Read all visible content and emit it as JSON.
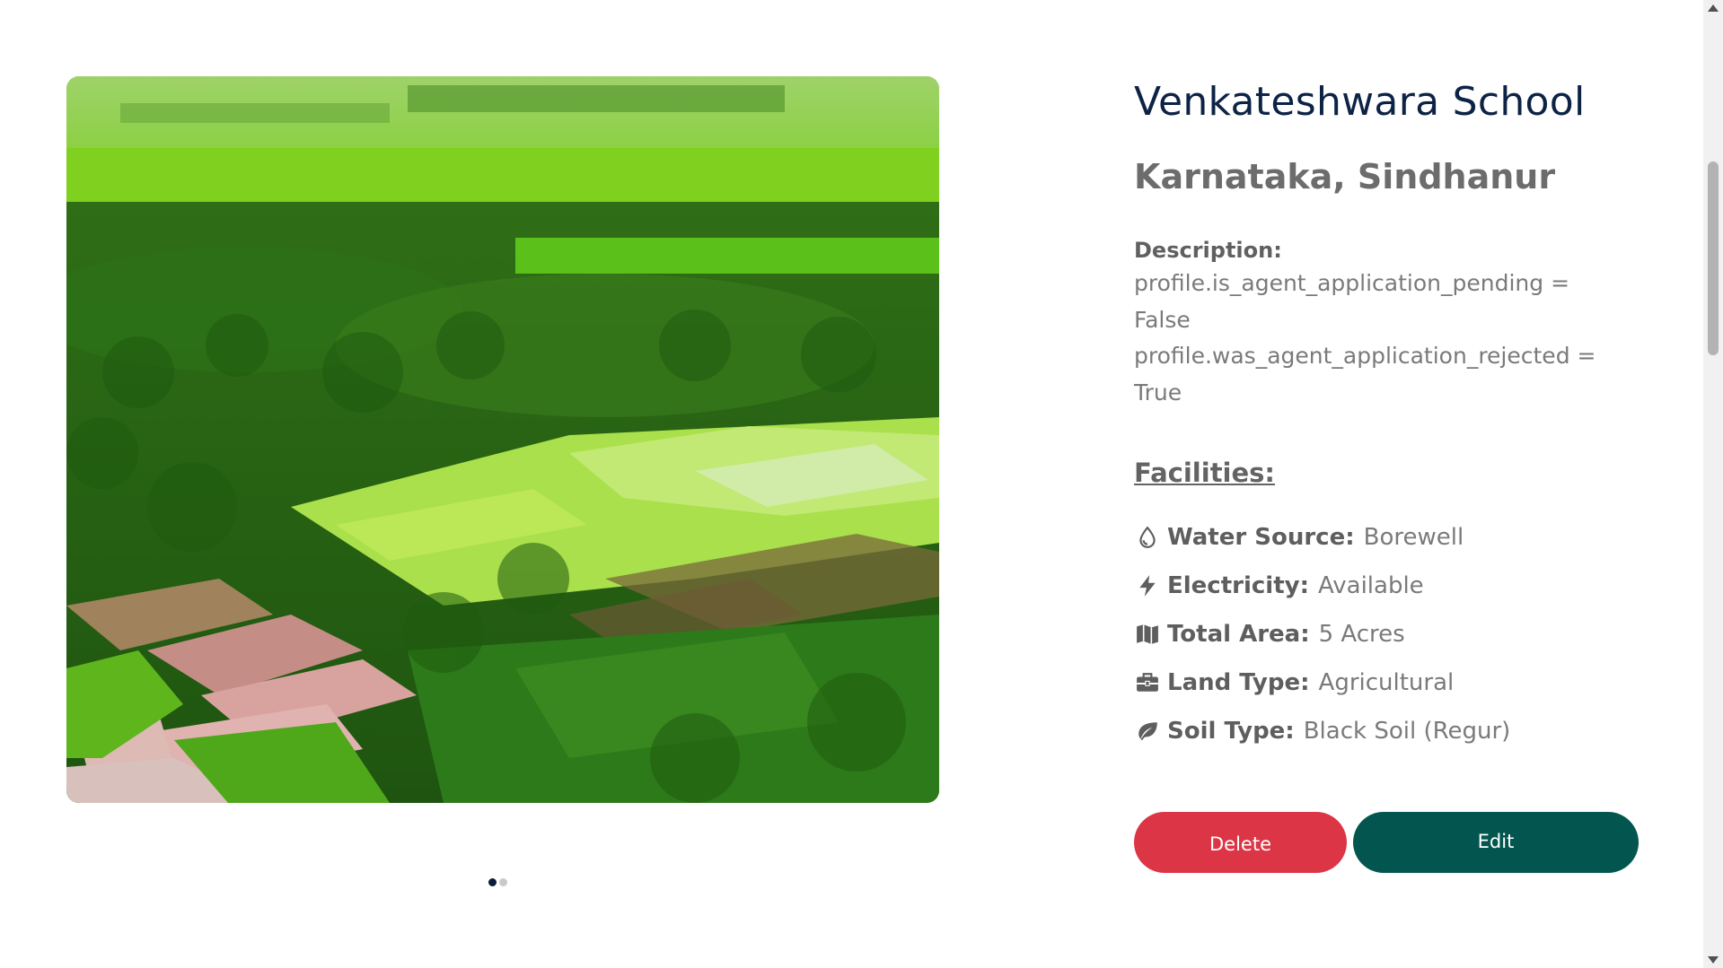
{
  "property": {
    "title": "Venkateshwara School",
    "location": "Karnataka, Sindhanur",
    "description_label": "Description:",
    "description_lines": [
      "profile.is_agent_application_pending =",
      "False",
      "profile.was_agent_application_rejected =",
      "True"
    ]
  },
  "facilities": {
    "title": "Facilities:",
    "items": [
      {
        "icon": "water-drop-icon",
        "label": "Water Source:",
        "value": "Borewell"
      },
      {
        "icon": "lightning-bolt-icon",
        "label": "Electricity:",
        "value": "Available"
      },
      {
        "icon": "map-icon",
        "label": "Total Area:",
        "value": "5 Acres"
      },
      {
        "icon": "briefcase-icon",
        "label": "Land Type:",
        "value": "Agricultural"
      },
      {
        "icon": "leaf-icon",
        "label": "Soil Type:",
        "value": "Black Soil (Regur)"
      }
    ]
  },
  "carousel": {
    "image": "aerial-farmland-photo",
    "slide_count": 2,
    "active_slide": 1
  },
  "actions": {
    "delete_label": "Delete",
    "edit_label": "Edit"
  },
  "colors": {
    "title": "#0d2345",
    "delete": "#dc3545",
    "edit": "#03564f"
  }
}
